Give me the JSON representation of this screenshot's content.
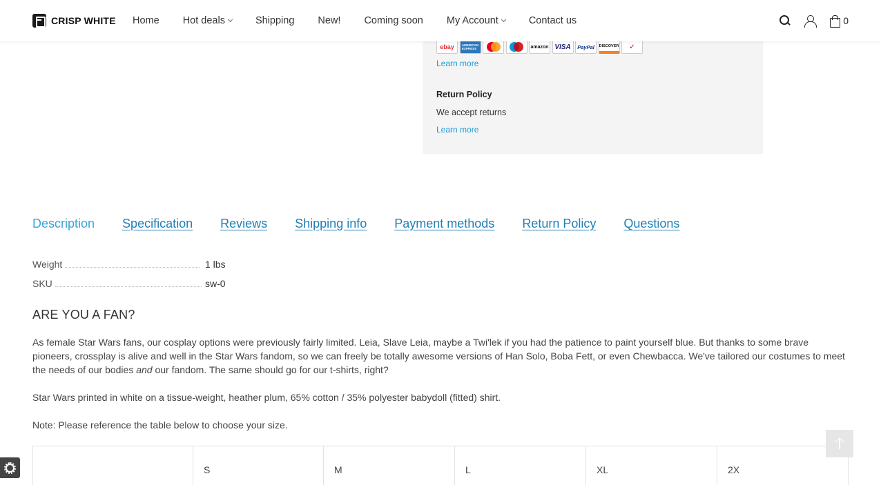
{
  "header": {
    "logo": "CRISP WHITE",
    "nav": [
      {
        "label": "Home",
        "dropdown": false
      },
      {
        "label": "Hot deals",
        "dropdown": true
      },
      {
        "label": "Shipping",
        "dropdown": false
      },
      {
        "label": "New!",
        "dropdown": false
      },
      {
        "label": "Coming soon",
        "dropdown": false
      },
      {
        "label": "My Account",
        "dropdown": true
      },
      {
        "label": "Contact us",
        "dropdown": false
      }
    ],
    "cart_count": "0"
  },
  "info_box": {
    "payment_icons": [
      "ebay",
      "American Express",
      "MasterCard",
      "Maestro",
      "amazon",
      "VISA",
      "PayPal",
      "DISCOVER",
      "eCheck"
    ],
    "learn_more_1": "Learn more",
    "return_title": "Return Policy",
    "return_text": "We accept returns",
    "learn_more_2": "Learn more"
  },
  "tabs": [
    "Description",
    "Specification",
    "Reviews",
    "Shipping info",
    "Payment methods",
    "Return Policy",
    "Questions"
  ],
  "specs": [
    {
      "label": "Weight",
      "value": "1 lbs"
    },
    {
      "label": "SKU",
      "value": "sw-0"
    }
  ],
  "description": {
    "heading": "ARE YOU A FAN?",
    "para1_a": "As female Star Wars fans, our cosplay options were previously fairly limited. Leia, Slave Leia, maybe a Twi'lek if you had the patience to paint yourself blue. But thanks to some brave pioneers, crossplay is alive and well in the Star Wars fandom, so we can freely be totally awesome versions of Han Solo, Boba Fett, or even Chewbacca. We've tailored our costumes to meet the needs of our bodies ",
    "para1_em": "and",
    "para1_b": " our fandom. The same should go for our t-shirts, right?",
    "para2": "Star Wars printed in white on a tissue-weight, heather plum, 65% cotton / 35% polyester babydoll (fitted) shirt.",
    "para3": "Note: Please reference the table below to choose your size."
  },
  "size_table": {
    "headers": [
      "",
      "S",
      "M",
      "L",
      "XL",
      "2X"
    ]
  }
}
